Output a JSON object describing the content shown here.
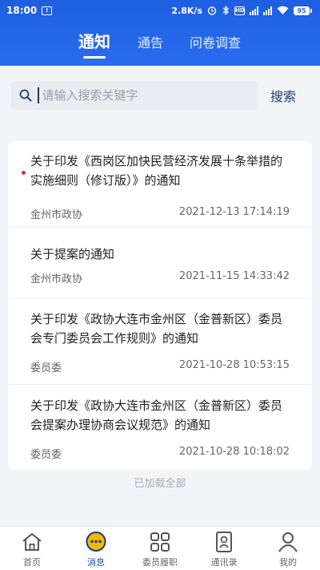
{
  "status_bar": {
    "time": "18:00",
    "network_speed": "2.8K/s",
    "battery": "95"
  },
  "tabs": [
    {
      "label": "通知",
      "active": true
    },
    {
      "label": "通告",
      "active": false
    },
    {
      "label": "问卷调查",
      "active": false
    }
  ],
  "search": {
    "placeholder": "请输入搜索关键字",
    "button_label": "搜索"
  },
  "notices": [
    {
      "title": "关于印发《西岗区加快民营经济发展十条举措的实施细则（修订版）》的通知",
      "source": "金州市政协",
      "datetime": "2021-12-13 17:14:19",
      "unread": true
    },
    {
      "title": "关于提案的通知",
      "source": "金州市政协",
      "datetime": "2021-11-15 14:33:42",
      "unread": false
    },
    {
      "title": "关于印发《政协大连市金州区（金普新区）委员会专门委员会工作规则》的通知",
      "source": "委员委",
      "datetime": "2021-10-28 10:53:15",
      "unread": false
    },
    {
      "title": "关于印发《政协大连市金州区（金普新区）委员会提案办理协商会议规范》的通知",
      "source": "委员委",
      "datetime": "2021-10-28 10:18:02",
      "unread": false
    }
  ],
  "list_footer": "已加载全部",
  "bottom_nav": [
    {
      "label": "首页",
      "icon": "home-icon",
      "active": false
    },
    {
      "label": "消息",
      "icon": "message-icon",
      "active": true
    },
    {
      "label": "委员履职",
      "icon": "grid-icon",
      "active": false
    },
    {
      "label": "通讯录",
      "icon": "contacts-icon",
      "active": false
    },
    {
      "label": "我的",
      "icon": "profile-icon",
      "active": false
    }
  ],
  "colors": {
    "header_blue": "#2c6cf0",
    "accent_dark_blue": "#1d4aa8",
    "unread_red": "#e52b2b",
    "message_icon_yellow": "#f5b800"
  }
}
